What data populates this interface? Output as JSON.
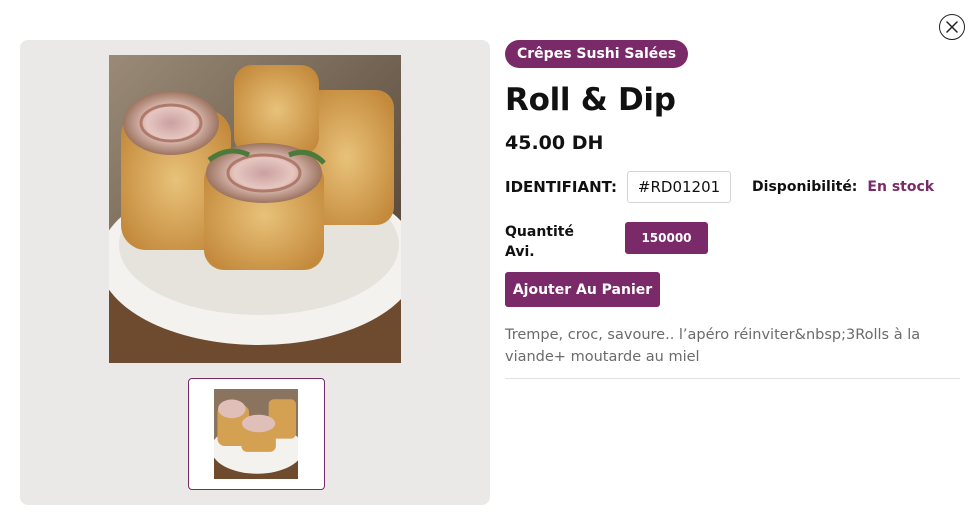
{
  "modal": {
    "close_icon": "close-icon"
  },
  "product": {
    "category": "Crêpes Sushi Salées",
    "name": "Roll & Dip",
    "price": "45.00 DH",
    "identifier_label": "IDENTIFIANT:",
    "identifier_value": "#RD01201",
    "availability_label": "Disponibilité:",
    "availability_value": "En stock",
    "quantity_label_line1": "Quantité",
    "quantity_label_line2": "Avi.",
    "quantity_value": "150000",
    "add_to_cart_label": "Ajouter Au Panier",
    "description": "Trempe, croc, savoure.. l’apéro réinviter&nbsp;3Rolls à la viande+ moutarde au miel"
  },
  "gallery": {
    "main_image": "product-photo-crepe-rolls",
    "thumbnails": [
      "product-photo-crepe-rolls"
    ]
  },
  "colors": {
    "accent": "#7b2a69",
    "gallery_bg": "#ebe9e7"
  }
}
